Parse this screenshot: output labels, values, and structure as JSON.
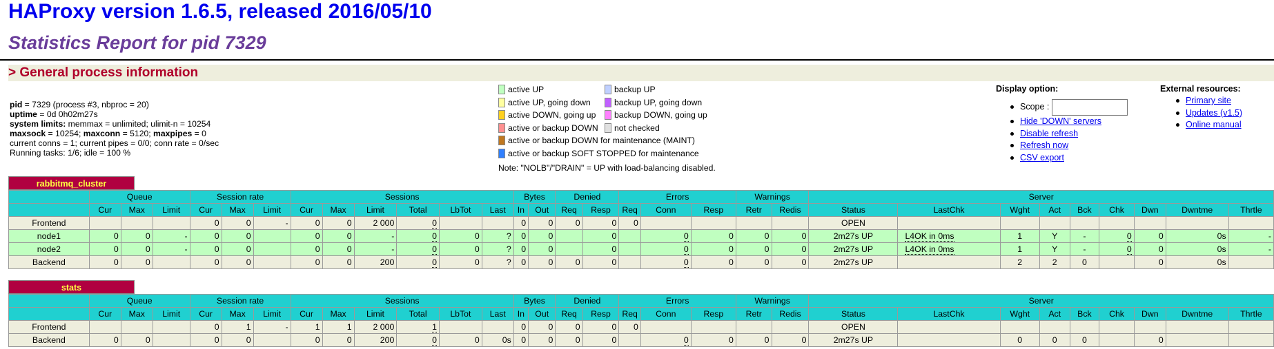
{
  "header": {
    "title": "HAProxy version 1.6.5, released 2016/05/10",
    "subtitle": "Statistics Report for pid 7329"
  },
  "general": {
    "section_title": "> General process information",
    "lines": [
      {
        "k": "pid",
        "v": " = 7329 (process #3, nbproc = 20)"
      },
      {
        "k": "uptime",
        "v": " = 0d 0h02m27s"
      },
      {
        "k": "system limits:",
        "v": " memmax = unlimited; ulimit-n = 10254"
      },
      {
        "k": "maxsock",
        "v": " = 10254; ",
        "k2": "maxconn",
        "v2": " = 5120; ",
        "k3": "maxpipes",
        "v3": " = 0"
      },
      {
        "k": "",
        "v": "current conns = 1; current pipes = 0/0; conn rate = 0/sec"
      },
      {
        "k": "",
        "v": "Running tasks: 1/6; idle = 100 %"
      }
    ]
  },
  "legend": {
    "col1": [
      {
        "label": "active UP",
        "color": "#c0ffc0"
      },
      {
        "label": "active UP, going down",
        "color": "#ffffa0"
      },
      {
        "label": "active DOWN, going up",
        "color": "#ffd020"
      },
      {
        "label": "active or backup DOWN",
        "color": "#ff9090"
      },
      {
        "label": "active or backup DOWN for maintenance (MAINT)",
        "color": "#c07820"
      },
      {
        "label": "active or backup SOFT STOPPED for maintenance",
        "color": "#3080ff"
      }
    ],
    "col2": [
      {
        "label": "backup UP",
        "color": "#c0d0ff"
      },
      {
        "label": "backup UP, going down",
        "color": "#c060ff"
      },
      {
        "label": "backup DOWN, going up",
        "color": "#ff80ff"
      },
      {
        "label": "not checked",
        "color": "#e0e0e0"
      }
    ],
    "note": "Note: \"NOLB\"/\"DRAIN\" = UP with load-balancing disabled."
  },
  "display": {
    "title": "Display option:",
    "scope_label": "Scope :",
    "links": [
      "Hide 'DOWN' servers",
      "Disable refresh",
      "Refresh now",
      "CSV export"
    ]
  },
  "external": {
    "title": "External resources:",
    "links": [
      "Primary site",
      "Updates (v1.5)",
      "Online manual"
    ]
  },
  "headers": {
    "groups": [
      "Queue",
      "Session rate",
      "Sessions",
      "Bytes",
      "Denied",
      "Errors",
      "Warnings",
      "Server"
    ],
    "cols": [
      "Cur",
      "Max",
      "Limit",
      "Cur",
      "Max",
      "Limit",
      "Cur",
      "Max",
      "Limit",
      "Total",
      "LbTot",
      "Last",
      "In",
      "Out",
      "Req",
      "Resp",
      "Req",
      "Conn",
      "Resp",
      "Retr",
      "Redis",
      "Status",
      "LastChk",
      "Wght",
      "Act",
      "Bck",
      "Chk",
      "Dwn",
      "Dwntme",
      "Thrtle"
    ]
  },
  "proxies": [
    {
      "name": "rabbitmq_cluster",
      "rows": [
        {
          "type": "frontend",
          "cells": [
            "Frontend",
            "",
            "",
            "",
            "0",
            "0",
            "-",
            "0",
            "0",
            "2 000",
            "0",
            "",
            "",
            "0",
            "0",
            "0",
            "0",
            "0",
            "",
            "",
            "",
            "",
            "OPEN",
            "",
            "",
            "",
            "",
            "",
            "",
            "",
            ""
          ]
        },
        {
          "type": "up",
          "cells": [
            "node1",
            "0",
            "0",
            "-",
            "0",
            "0",
            "",
            "0",
            "0",
            "-",
            "0",
            "0",
            "?",
            "0",
            "0",
            "",
            "0",
            "",
            "0",
            "0",
            "0",
            "0",
            "2m27s UP",
            "L4OK in 0ms",
            "1",
            "Y",
            "-",
            "0",
            "0",
            "0s",
            "-"
          ]
        },
        {
          "type": "up",
          "cells": [
            "node2",
            "0",
            "0",
            "-",
            "0",
            "0",
            "",
            "0",
            "0",
            "-",
            "0",
            "0",
            "?",
            "0",
            "0",
            "",
            "0",
            "",
            "0",
            "0",
            "0",
            "0",
            "2m27s UP",
            "L4OK in 0ms",
            "1",
            "Y",
            "-",
            "0",
            "0",
            "0s",
            "-"
          ]
        },
        {
          "type": "backend",
          "cells": [
            "Backend",
            "0",
            "0",
            "",
            "0",
            "0",
            "",
            "0",
            "0",
            "200",
            "0",
            "0",
            "?",
            "0",
            "0",
            "0",
            "0",
            "",
            "0",
            "0",
            "0",
            "0",
            "2m27s UP",
            "",
            "2",
            "2",
            "0",
            "",
            "0",
            "0s",
            ""
          ]
        }
      ]
    },
    {
      "name": "stats",
      "rows": [
        {
          "type": "frontend",
          "cells": [
            "Frontend",
            "",
            "",
            "",
            "0",
            "1",
            "-",
            "1",
            "1",
            "2 000",
            "1",
            "",
            "",
            "0",
            "0",
            "0",
            "0",
            "0",
            "",
            "",
            "",
            "",
            "OPEN",
            "",
            "",
            "",
            "",
            "",
            "",
            "",
            ""
          ]
        },
        {
          "type": "backend",
          "cells": [
            "Backend",
            "0",
            "0",
            "",
            "0",
            "0",
            "",
            "0",
            "0",
            "200",
            "0",
            "0",
            "0s",
            "0",
            "0",
            "0",
            "0",
            "",
            "0",
            "0",
            "0",
            "0",
            "2m27s UP",
            "",
            "0",
            "0",
            "0",
            "",
            "0",
            "",
            ""
          ]
        }
      ]
    }
  ]
}
